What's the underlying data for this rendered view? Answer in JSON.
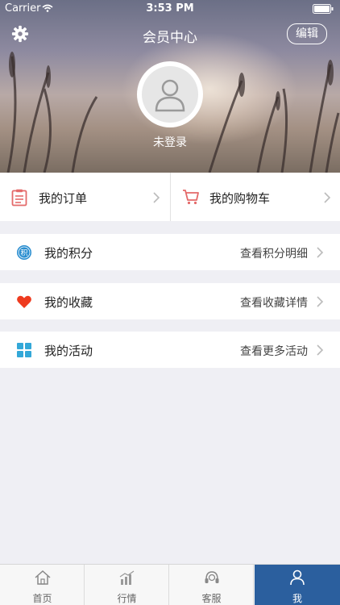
{
  "status": {
    "carrier": "Carrier",
    "time": "3:53 PM"
  },
  "header": {
    "title": "会员中心",
    "edit_label": "编辑",
    "login_text": "未登录"
  },
  "orders": {
    "my_orders": "我的订单",
    "cart": "我的购物车"
  },
  "rows": [
    {
      "label": "我的积分",
      "detail": "查看积分明细",
      "icon": "points-icon",
      "badge": "积"
    },
    {
      "label": "我的收藏",
      "detail": "查看收藏详情",
      "icon": "heart-icon"
    },
    {
      "label": "我的活动",
      "detail": "查看更多活动",
      "icon": "grid-icon"
    }
  ],
  "tabs": [
    {
      "label": "首页",
      "icon": "home-icon"
    },
    {
      "label": "行情",
      "icon": "chart-icon"
    },
    {
      "label": "客服",
      "icon": "headset-icon"
    },
    {
      "label": "我",
      "icon": "person-icon",
      "active": true
    }
  ],
  "colors": {
    "accent": "#2b5f9e",
    "order_icon": "#e46a6a",
    "heart": "#ee3b1f",
    "points": "#2a8ed0",
    "grid": "#33a8d8"
  }
}
